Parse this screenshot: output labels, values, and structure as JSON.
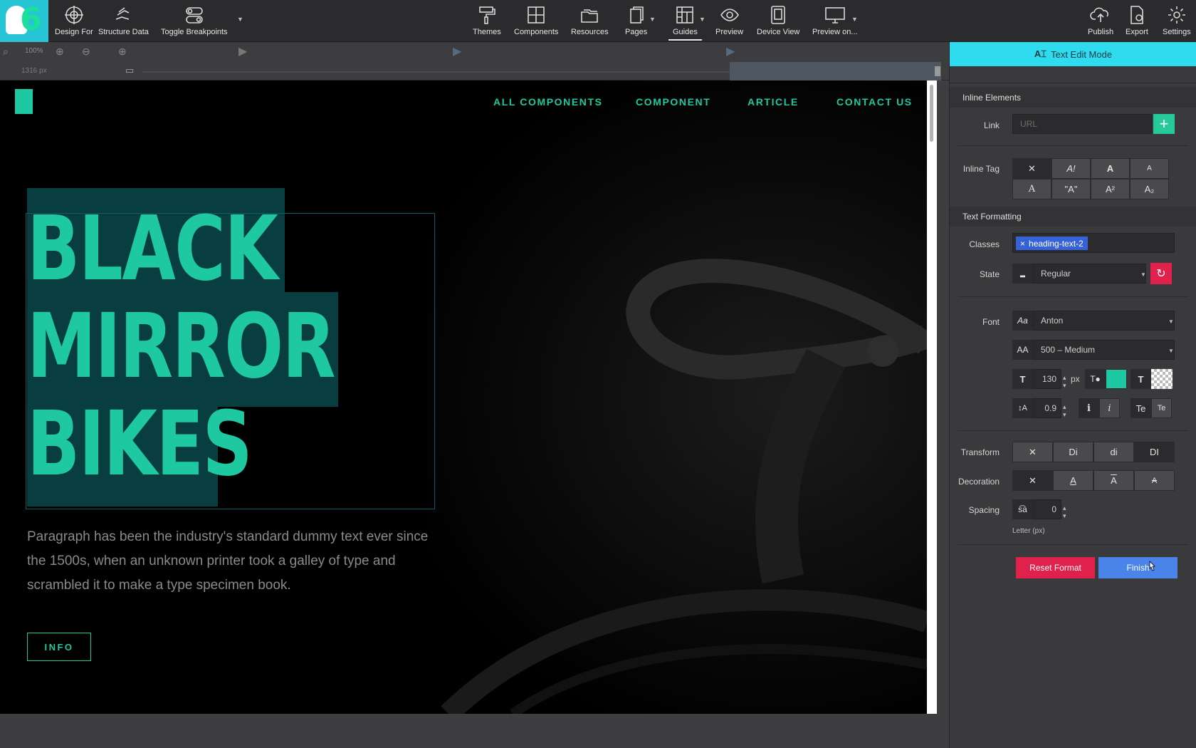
{
  "toolbar": {
    "left": [
      {
        "label": "Design For",
        "icon": "crosshair-circle-icon"
      },
      {
        "label": "Structure Data",
        "icon": "hand-structure-icon"
      },
      {
        "label": "Toggle Breakpoints",
        "icon": "toggles-icon"
      }
    ],
    "center": [
      {
        "label": "Themes",
        "icon": "paint-roller-icon"
      },
      {
        "label": "Components",
        "icon": "components-grid-icon"
      },
      {
        "label": "Resources",
        "icon": "folders-icon"
      },
      {
        "label": "Pages",
        "icon": "pages-icon"
      },
      {
        "label": "Guides",
        "icon": "guides-grid-icon"
      },
      {
        "label": "Preview",
        "icon": "eye-icon"
      },
      {
        "label": "Device View",
        "icon": "devices-icon"
      },
      {
        "label": "Preview on...",
        "icon": "monitor-icon"
      }
    ],
    "right": [
      {
        "label": "Publish",
        "icon": "cloud-upload-icon"
      },
      {
        "label": "Export",
        "icon": "export-file-icon"
      },
      {
        "label": "Settings",
        "icon": "gear-icon"
      }
    ]
  },
  "subbar": {
    "zoom": "100%",
    "width": "1316 px"
  },
  "site": {
    "nav": [
      "ALL COMPONENTS",
      "COMPONENT",
      "ARTICLE",
      "CONTACT US"
    ],
    "hero_title": "BLACK\nMIRROR\nBIKES",
    "paragraph": "Paragraph has been the industry's standard dummy text ever since the 1500s, when an unknown printer took a galley of type and scrambled it to make a type specimen book.",
    "button": "INFO",
    "accent": "#1ec8a0"
  },
  "panel": {
    "mode": "Text Edit Mode",
    "inline_elements": {
      "title": "Inline Elements",
      "link_label": "Link",
      "link_placeholder": "URL",
      "inline_tag_label": "Inline Tag",
      "inline_tags_row1": [
        "✕",
        "A!",
        "A",
        "A"
      ],
      "inline_tags_row2": [
        "A",
        "\"A\"",
        "A²",
        "A₂"
      ]
    },
    "text_formatting": {
      "title": "Text Formatting",
      "classes_label": "Classes",
      "class_chip": "heading-text-2",
      "state_label": "State",
      "state_value": "Regular",
      "font_label": "Font",
      "font_value": "Anton",
      "weight_value": "500 – Medium",
      "size_value": "130",
      "size_unit": "px",
      "line_height_value": "0.9",
      "color": "#1ec8a0",
      "style_buttons": [
        "i",
        "i",
        "Te",
        "Te"
      ],
      "transform_label": "Transform",
      "transform_options": [
        "✕",
        "Di",
        "di",
        "DI"
      ],
      "decoration_label": "Decoration",
      "decoration_options": [
        "✕",
        "A",
        "A",
        "A"
      ],
      "spacing_label": "Spacing",
      "spacing_value": "0",
      "spacing_caption": "Letter (px)"
    },
    "reset_label": "Reset Format",
    "finish_label": "Finish"
  }
}
